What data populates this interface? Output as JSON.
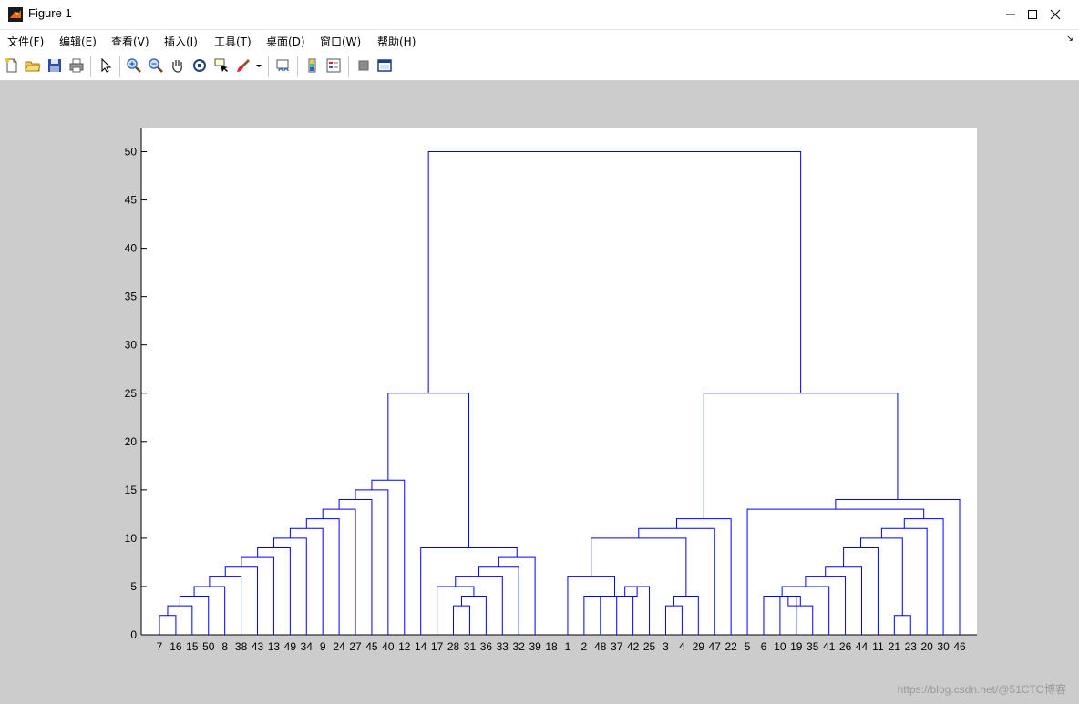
{
  "window": {
    "title": "Figure 1",
    "controls": {
      "minimize": "minimize-icon",
      "maximize": "maximize-icon",
      "close": "close-icon"
    }
  },
  "menu": {
    "items": [
      {
        "label": "文件(F)"
      },
      {
        "label": "编辑(E)"
      },
      {
        "label": "查看(V)"
      },
      {
        "label": "插入(I)"
      },
      {
        "label": "工具(T)"
      },
      {
        "label": "桌面(D)"
      },
      {
        "label": "窗口(W)"
      },
      {
        "label": "帮助(H)"
      }
    ],
    "corner": "↘"
  },
  "toolbar": {
    "buttons": [
      {
        "icon": "new-figure-icon"
      },
      {
        "icon": "open-file-icon"
      },
      {
        "icon": "save-icon"
      },
      {
        "icon": "print-icon"
      },
      {
        "icon": "select-arrow-icon"
      },
      {
        "icon": "zoom-in-icon"
      },
      {
        "icon": "zoom-out-icon"
      },
      {
        "icon": "pan-hand-icon"
      },
      {
        "icon": "rotate-3d-icon"
      },
      {
        "icon": "data-cursor-icon"
      },
      {
        "icon": "brush-icon"
      },
      {
        "icon": "link-plot-icon"
      },
      {
        "icon": "colorbar-icon"
      },
      {
        "icon": "legend-icon"
      },
      {
        "icon": "hide-plot-tools-icon"
      },
      {
        "icon": "show-plot-tools-icon"
      }
    ]
  },
  "colors": {
    "line": "#0000ff",
    "background": "#cccccc",
    "axes": "#ffffff"
  },
  "watermark": "https://blog.csdn.net/@51CTO博客",
  "chart_data": {
    "type": "dendrogram",
    "ylim": [
      0,
      52.5
    ],
    "yticks": [
      0,
      5,
      10,
      15,
      20,
      25,
      30,
      35,
      40,
      45,
      50
    ],
    "leaf_order": [
      "7",
      "16",
      "15",
      "50",
      "8",
      "38",
      "43",
      "13",
      "49",
      "34",
      "9",
      "24",
      "27",
      "45",
      "40",
      "12",
      "14",
      "17",
      "28",
      "31",
      "36",
      "33",
      "32",
      "39",
      "18",
      "1",
      "2",
      "48",
      "37",
      "42",
      "25",
      "3",
      "4",
      "29",
      "47",
      "22",
      "5",
      "6",
      "10",
      "19",
      "35",
      "41",
      "26",
      "44",
      "11",
      "21",
      "23",
      "20",
      "30",
      "46"
    ],
    "merges": [
      {
        "a": "L0",
        "b": "L1",
        "h": 2
      },
      {
        "a": "M0",
        "b": "L2",
        "h": 3
      },
      {
        "a": "M1",
        "b": "L3",
        "h": 4
      },
      {
        "a": "M2",
        "b": "L4",
        "h": 5
      },
      {
        "a": "M3",
        "b": "L5",
        "h": 6
      },
      {
        "a": "M4",
        "b": "L6",
        "h": 7
      },
      {
        "a": "M5",
        "b": "L7",
        "h": 8
      },
      {
        "a": "M6",
        "b": "L8",
        "h": 9
      },
      {
        "a": "M7",
        "b": "L9",
        "h": 10
      },
      {
        "a": "M8",
        "b": "L10",
        "h": 11
      },
      {
        "a": "M9",
        "b": "L11",
        "h": 12
      },
      {
        "a": "M10",
        "b": "L12",
        "h": 13
      },
      {
        "a": "M11",
        "b": "L13",
        "h": 14
      },
      {
        "a": "M12",
        "b": "L14",
        "h": 15
      },
      {
        "a": "M13",
        "b": "L15",
        "h": 16
      },
      {
        "a": "L18",
        "b": "L19",
        "h": 3
      },
      {
        "a": "M15",
        "b": "L20",
        "h": 4
      },
      {
        "a": "L17",
        "b": "M16",
        "h": 5
      },
      {
        "a": "M17",
        "b": "L21",
        "h": 6
      },
      {
        "a": "M18",
        "b": "L22",
        "h": 7
      },
      {
        "a": "M19",
        "b": "L23",
        "h": 8
      },
      {
        "a": "L16",
        "b": "M20",
        "h": 9
      },
      {
        "a": "M14",
        "b": "M21",
        "h": 25
      },
      {
        "a": "L26",
        "b": "L27",
        "h": 4
      },
      {
        "a": "L28",
        "b": "L29",
        "h": 4
      },
      {
        "a": "M24",
        "b": "L30",
        "h": 5
      },
      {
        "a": "M23",
        "b": "M25",
        "h": 4
      },
      {
        "a": "L25",
        "b": "M26",
        "h": 6
      },
      {
        "a": "L31",
        "b": "L32",
        "h": 3
      },
      {
        "a": "M28",
        "b": "L33",
        "h": 4
      },
      {
        "a": "M27",
        "b": "M29",
        "h": 10
      },
      {
        "a": "M30",
        "b": "L34",
        "h": 11
      },
      {
        "a": "M31",
        "b": "L35",
        "h": 12
      },
      {
        "a": "L38",
        "b": "L39",
        "h": 4
      },
      {
        "a": "M33",
        "b": "L40",
        "h": 3
      },
      {
        "a": "L37",
        "b": "M34",
        "h": 4
      },
      {
        "a": "M35",
        "b": "L41",
        "h": 5
      },
      {
        "a": "M36",
        "b": "L42",
        "h": 6
      },
      {
        "a": "M37",
        "b": "L43",
        "h": 7
      },
      {
        "a": "M38",
        "b": "L44",
        "h": 9
      },
      {
        "a": "L45",
        "b": "L46",
        "h": 2
      },
      {
        "a": "M39",
        "b": "M40",
        "h": 10
      },
      {
        "a": "M41",
        "b": "L47",
        "h": 11
      },
      {
        "a": "M42",
        "b": "L48",
        "h": 12
      },
      {
        "a": "L36",
        "b": "M43",
        "h": 13
      },
      {
        "a": "M44",
        "b": "L49",
        "h": 14
      },
      {
        "a": "M32",
        "b": "M45",
        "h": 25
      },
      {
        "a": "M22",
        "b": "M46",
        "h": 50
      }
    ]
  }
}
